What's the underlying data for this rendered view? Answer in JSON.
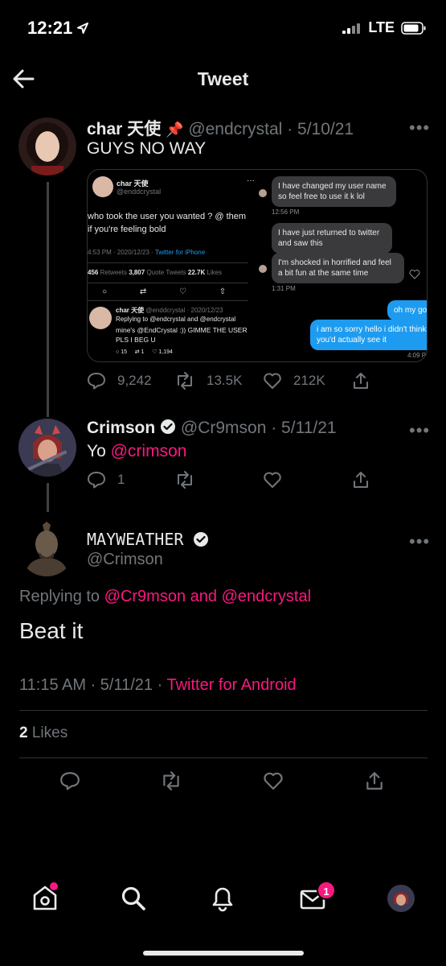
{
  "status_bar": {
    "time": "12:21",
    "network": "LTE"
  },
  "header": {
    "title": "Tweet"
  },
  "tweet1": {
    "name": "char 天使",
    "pin": "📌",
    "handle": "@endcrystal",
    "date": "· 5/10/21",
    "text": "GUYS NO WAY",
    "stats": {
      "replies": "9,242",
      "retweets": "13.5K",
      "likes": "212K"
    }
  },
  "embed": {
    "name": "char 天使",
    "handle": "@enddcrystal",
    "text": "who took the user you wanted ? @ them if you're feeling bold",
    "time": "4:53 PM · 2020/12/23 ·",
    "source": "Twitter for iPhone",
    "retweets_num": "456",
    "retweets_label": "Retweets",
    "quotes_num": "3,807",
    "quotes_label": "Quote Tweets",
    "likes_num": "22.7K",
    "likes_label": "Likes",
    "reply_name": "char 天使",
    "reply_meta": "@enddcrystal · 2020/12/23",
    "reply_replying": "Replying to @endcrystal and @endcrystal",
    "reply_text": "mine's @EndCrystal :)) GIMME THE USER PLS I BEG U",
    "reply_counts": {
      "replies": "15",
      "retweets": "1",
      "likes": "1,194"
    },
    "dm": {
      "msg1": "I have changed my user name so feel free to use it k lol",
      "time1": "12:56 PM",
      "msg2": "I have just returned to twitter and saw this",
      "msg3": "I'm shocked in horrified and feel a bit fun at the same time",
      "time2": "1:31 PM",
      "msg4": "oh my go",
      "msg5": "i am so sorry hello i didn't think you'd actually see it",
      "time3": "4:09 P"
    }
  },
  "tweet2": {
    "name": "Crimson",
    "handle": "@Cr9mson",
    "date": "· 5/11/21",
    "text_prefix": "Yo",
    "mention": "@crimson",
    "stats": {
      "replies": "1"
    }
  },
  "main_tweet": {
    "name": "MAYWEATHER",
    "handle": "@Crimson",
    "replying_prefix": "Replying to",
    "replying_user1": "@Cr9mson",
    "replying_and": "and",
    "replying_user2": "@endcrystal",
    "text": "Beat it",
    "time": "11:15 AM · 5/11/21 ·",
    "source": "Twitter for Android",
    "likes_count": "2",
    "likes_label": "Likes"
  },
  "bottom_nav": {
    "messages_badge": "1"
  },
  "colors": {
    "accent": "#f91880",
    "blue": "#1d9bf0",
    "muted": "#71767b",
    "background": "#000000"
  }
}
